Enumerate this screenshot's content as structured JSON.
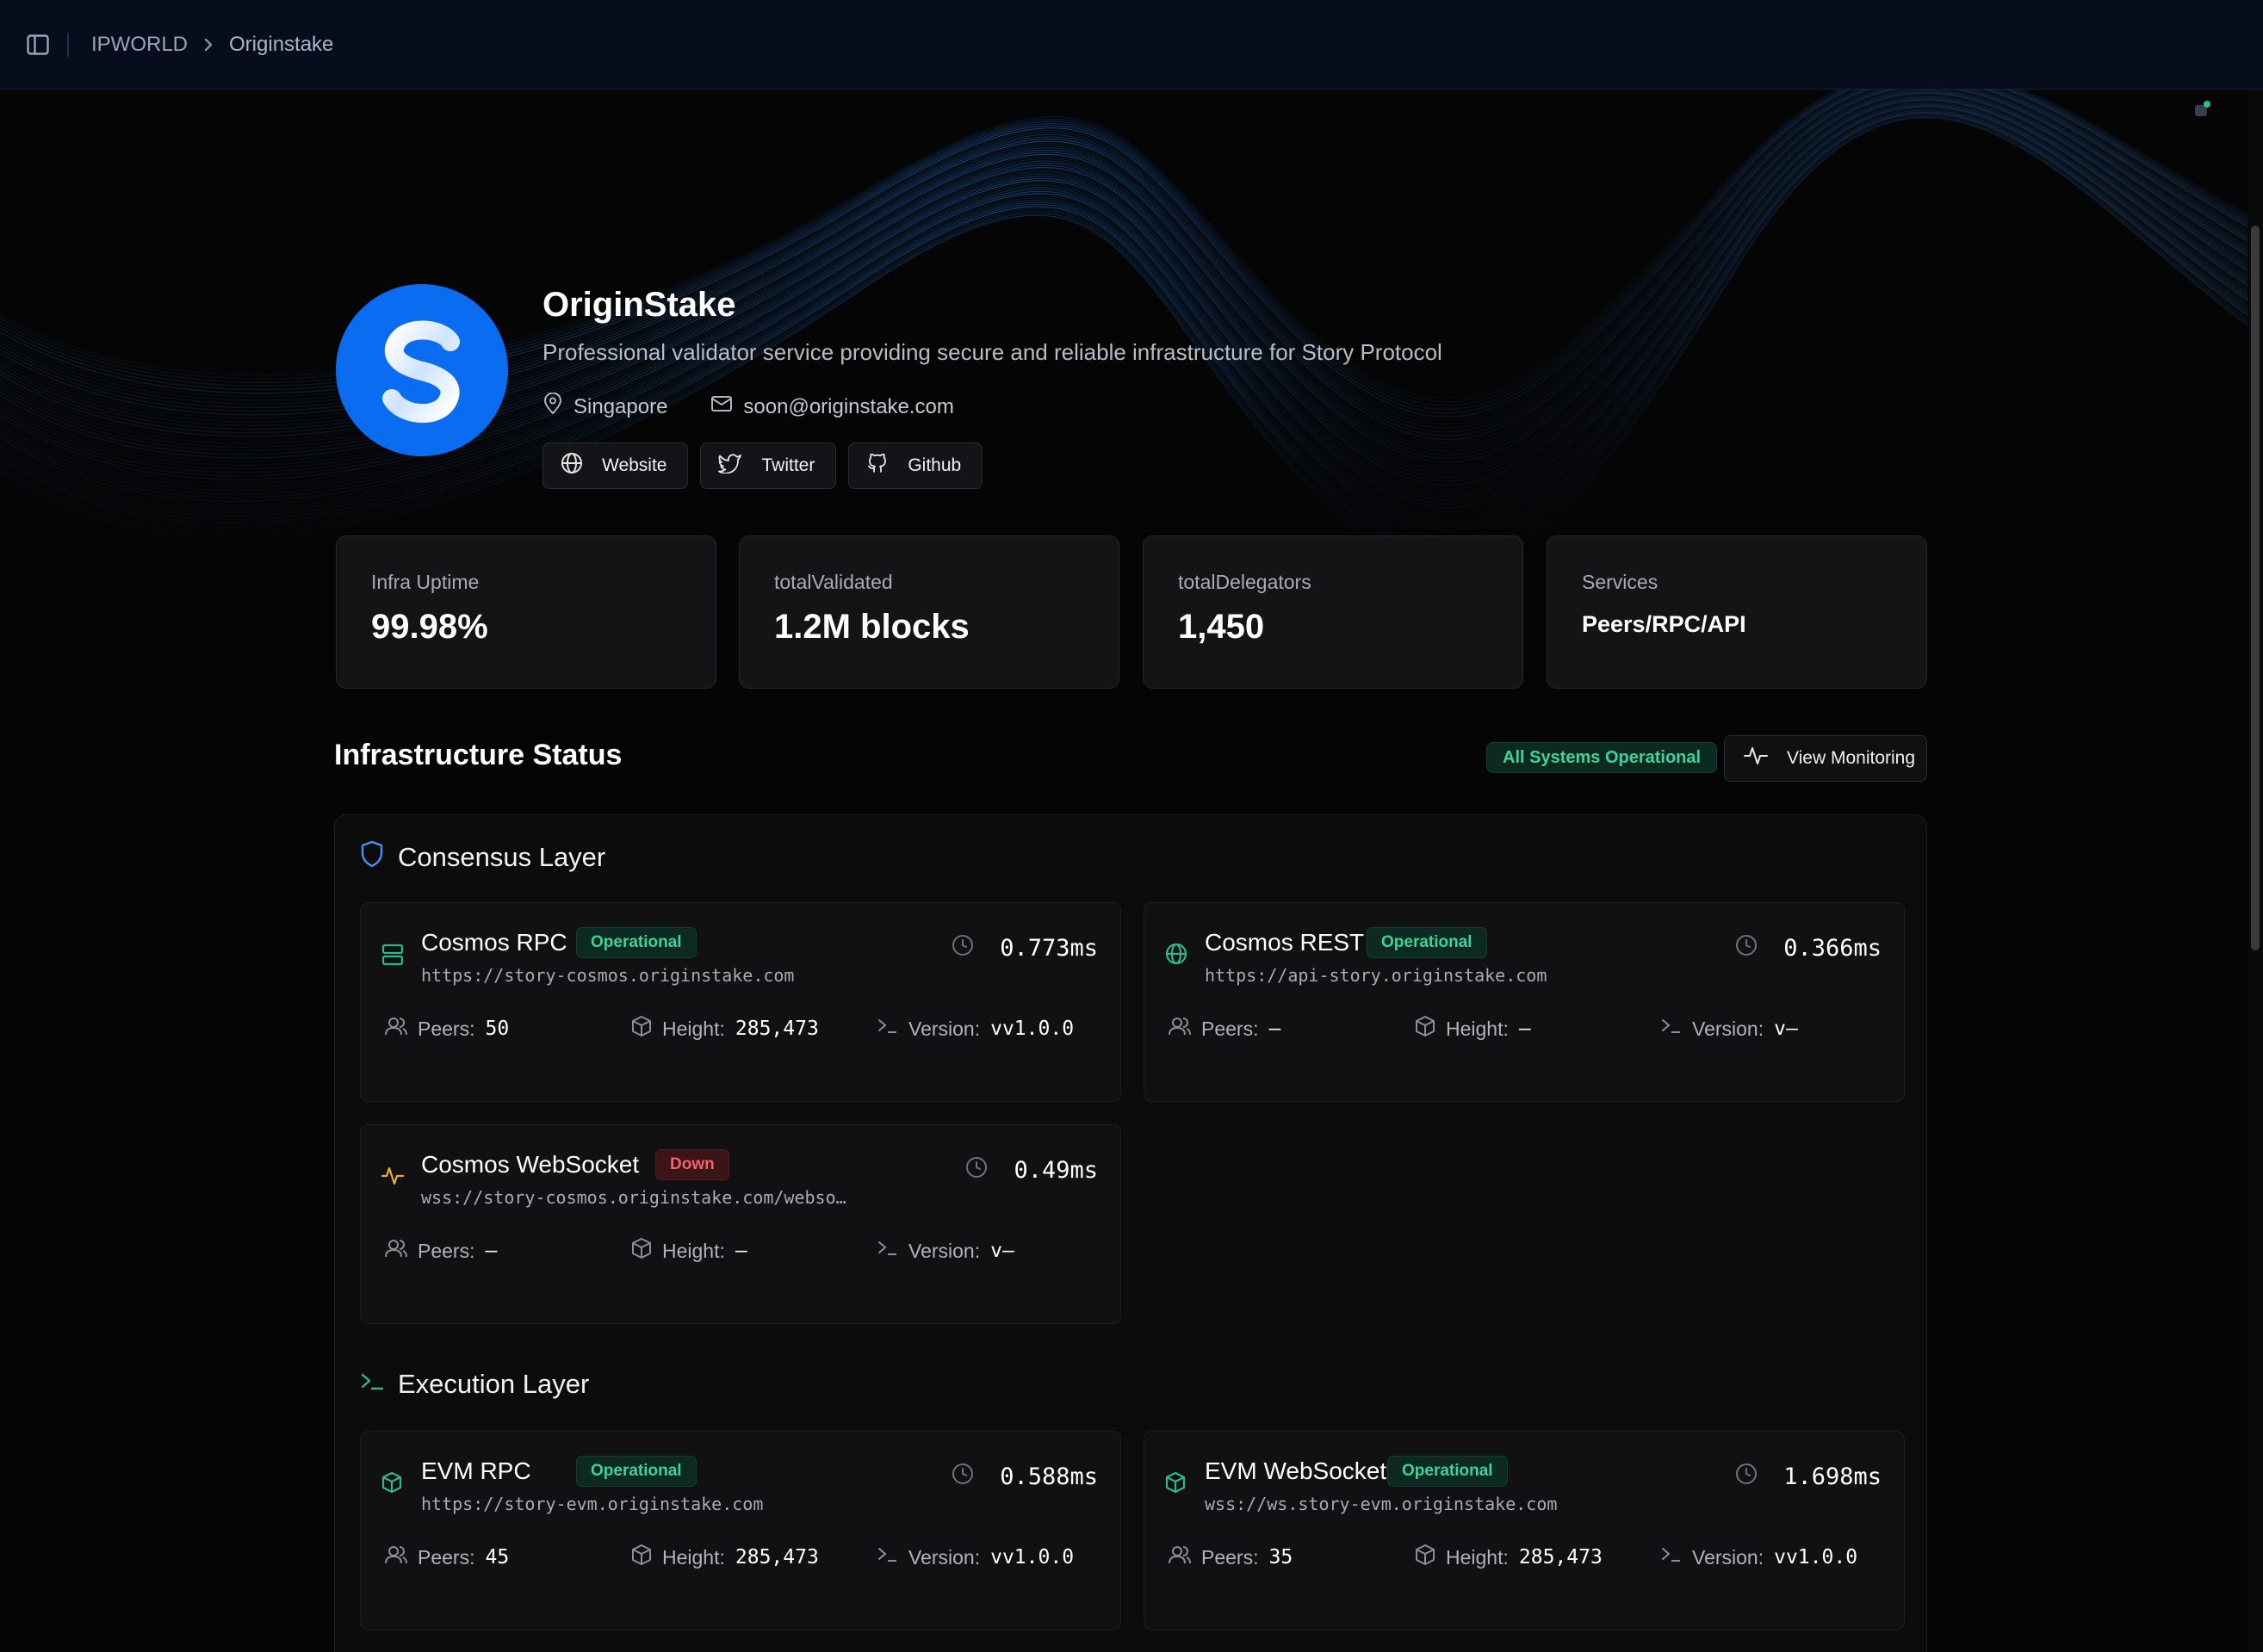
{
  "topbar": {
    "breadcrumb": [
      "IPWORLD",
      "Originstake"
    ]
  },
  "profile": {
    "name": "OriginStake",
    "description": "Professional validator service providing secure and reliable infrastructure for Story Protocol",
    "location": "Singapore",
    "email": "soon@originstake.com",
    "links": [
      {
        "label": "Website",
        "icon": "globe-icon"
      },
      {
        "label": "Twitter",
        "icon": "twitter-icon"
      },
      {
        "label": "Github",
        "icon": "github-icon"
      }
    ]
  },
  "stats": [
    {
      "label": "Infra Uptime",
      "value": "99.98%"
    },
    {
      "label": "totalValidated",
      "value": "1.2M blocks"
    },
    {
      "label": "totalDelegators",
      "value": "1,450"
    },
    {
      "label": "Services",
      "value": "Peers/RPC/API"
    }
  ],
  "infra": {
    "title": "Infrastructure Status",
    "overall_status": "All Systems Operational",
    "view_monitoring": "View Monitoring",
    "layers": [
      {
        "title": "Consensus Layer",
        "icon": "shield-icon",
        "services": [
          {
            "name": "Cosmos RPC",
            "status": "Operational",
            "url": "https://story-cosmos.originstake.com",
            "latency": "0.773ms",
            "peers": "50",
            "height": "285,473",
            "version": "vv1.0.0",
            "icon": "server-icon"
          },
          {
            "name": "Cosmos REST",
            "status": "Operational",
            "url": "https://api-story.originstake.com",
            "latency": "0.366ms",
            "peers": "–",
            "height": "–",
            "version": "v–",
            "icon": "globe-icon"
          },
          {
            "name": "Cosmos WebSocket",
            "status": "Down",
            "url": "wss://story-cosmos.originstake.com/webso…",
            "latency": "0.49ms",
            "peers": "–",
            "height": "–",
            "version": "v–",
            "icon": "activity-icon"
          }
        ]
      },
      {
        "title": "Execution Layer",
        "icon": "terminal-icon",
        "services": [
          {
            "name": "EVM RPC",
            "status": "Operational",
            "url": "https://story-evm.originstake.com",
            "latency": "0.588ms",
            "peers": "45",
            "height": "285,473",
            "version": "vv1.0.0",
            "icon": "cube-icon"
          },
          {
            "name": "EVM WebSocket",
            "status": "Operational",
            "url": "wss://ws.story-evm.originstake.com",
            "latency": "1.698ms",
            "peers": "35",
            "height": "285,473",
            "version": "vv1.0.0",
            "icon": "cube-icon"
          }
        ]
      }
    ],
    "metric_labels": {
      "peers": "Peers:",
      "height": "Height:",
      "version": "Version:"
    }
  },
  "colors": {
    "accent_green": "#3fd39a",
    "down_red": "#f0646a",
    "brand_blue": "#0a6cf0",
    "background": "#050506"
  }
}
